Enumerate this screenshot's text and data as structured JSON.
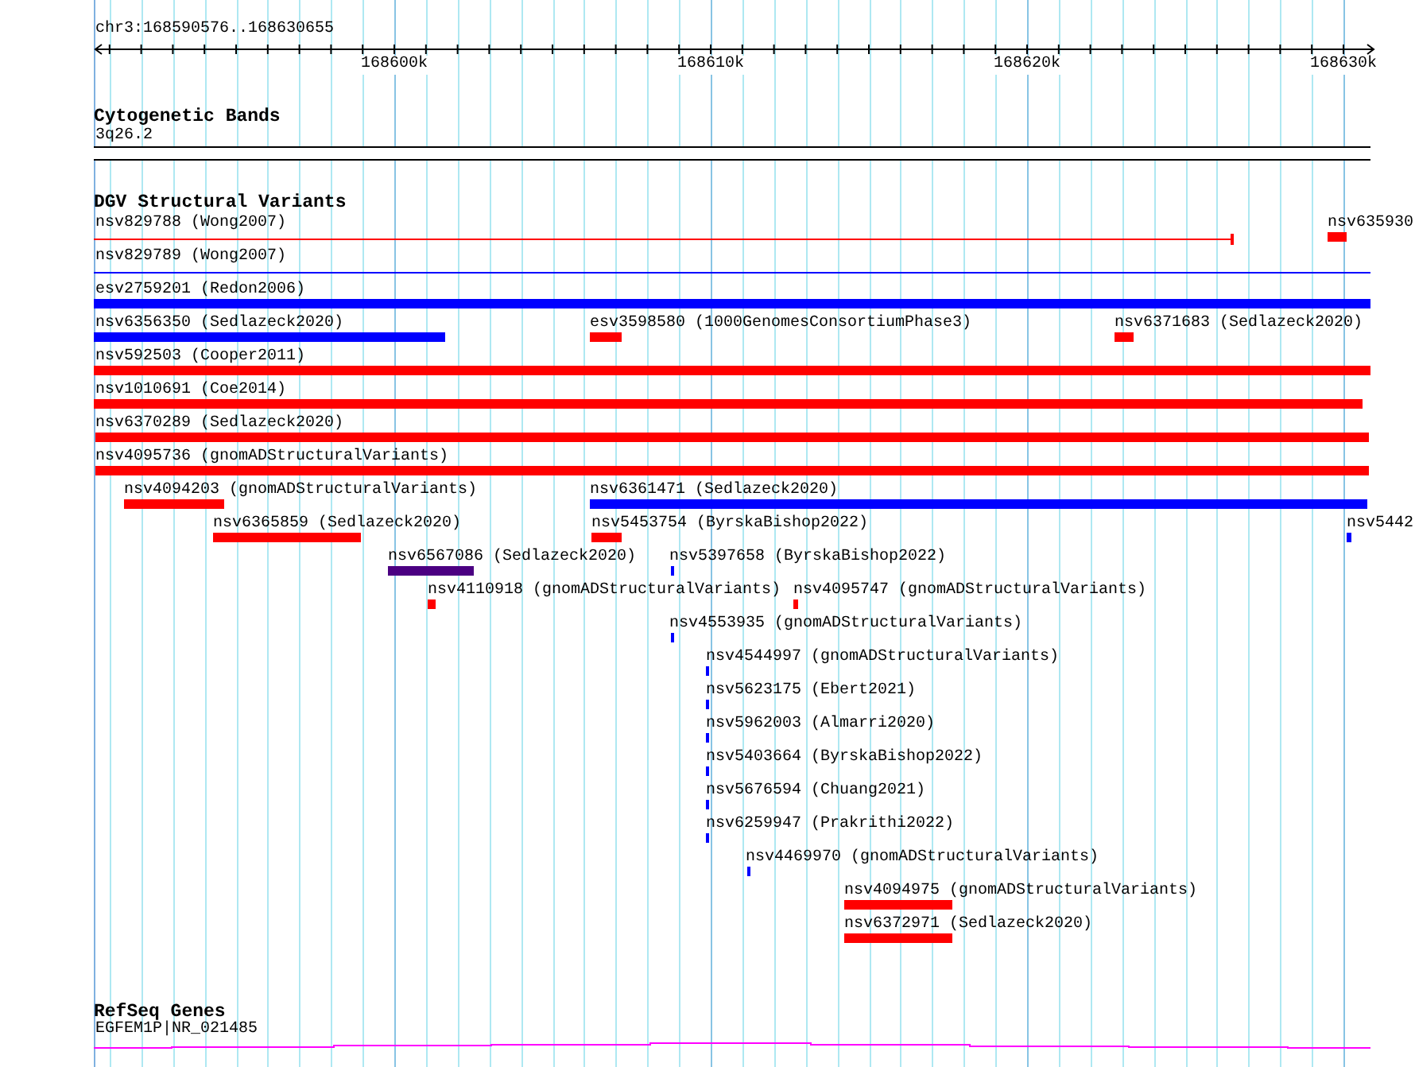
{
  "ruler": {
    "position": "chr3:168590576..168630655",
    "ticks": [
      "168600k",
      "168610k",
      "168620k",
      "168630k"
    ]
  },
  "tracks": [
    {
      "title": "Cytogenetic Bands",
      "kind": "bands",
      "items": [
        {
          "label": "3q26.2"
        }
      ]
    },
    {
      "title": "DGV Structural Variants",
      "kind": "variants",
      "items": [
        {
          "label": "nsv829788 (Wong2007)",
          "color": "#ff0000",
          "kind": "line"
        },
        {
          "label": "nsv635930",
          "color": "#ff0000",
          "kind": "bar"
        },
        {
          "label": "nsv829789 (Wong2007)",
          "color": "#0000ff",
          "kind": "line"
        },
        {
          "label": "esv2759201 (Redon2006)",
          "color": "#0000ff",
          "kind": "bar"
        },
        {
          "label": "nsv6356350 (Sedlazeck2020)",
          "color": "#0000ff",
          "kind": "bar"
        },
        {
          "label": "esv3598580 (1000GenomesConsortiumPhase3)",
          "color": "#ff0000",
          "kind": "bar"
        },
        {
          "label": "nsv6371683 (Sedlazeck2020)",
          "color": "#ff0000",
          "kind": "bar"
        },
        {
          "label": "nsv592503 (Cooper2011)",
          "color": "#ff0000",
          "kind": "bar"
        },
        {
          "label": "nsv1010691 (Coe2014)",
          "color": "#ff0000",
          "kind": "bar"
        },
        {
          "label": "nsv6370289 (Sedlazeck2020)",
          "color": "#ff0000",
          "kind": "bar"
        },
        {
          "label": "nsv4095736 (gnomADStructuralVariants)",
          "color": "#ff0000",
          "kind": "bar"
        },
        {
          "label": "nsv4094203 (gnomADStructuralVariants)",
          "color": "#ff0000",
          "kind": "bar"
        },
        {
          "label": "nsv6361471 (Sedlazeck2020)",
          "color": "#0000ff",
          "kind": "bar"
        },
        {
          "label": "nsv6365859 (Sedlazeck2020)",
          "color": "#ff0000",
          "kind": "bar"
        },
        {
          "label": "nsv5453754 (ByrskaBishop2022)",
          "color": "#ff0000",
          "kind": "bar"
        },
        {
          "label": "nsv5442",
          "color": "#0000ff",
          "kind": "bar"
        },
        {
          "label": "nsv6567086 (Sedlazeck2020)",
          "color": "#4b0082",
          "kind": "bar"
        },
        {
          "label": "nsv5397658 (ByrskaBishop2022)",
          "color": "#0000ff",
          "kind": "bar"
        },
        {
          "label": "nsv4110918 (gnomADStructuralVariants)",
          "color": "#ff0000",
          "kind": "bar"
        },
        {
          "label": "nsv4095747 (gnomADStructuralVariants)",
          "color": "#ff0000",
          "kind": "bar"
        },
        {
          "label": "nsv4553935 (gnomADStructuralVariants)",
          "color": "#0000ff",
          "kind": "bar"
        },
        {
          "label": "nsv4544997 (gnomADStructuralVariants)",
          "color": "#0000ff",
          "kind": "bar"
        },
        {
          "label": "nsv5623175 (Ebert2021)",
          "color": "#0000ff",
          "kind": "bar"
        },
        {
          "label": "nsv5962003 (Almarri2020)",
          "color": "#0000ff",
          "kind": "bar"
        },
        {
          "label": "nsv5403664 (ByrskaBishop2022)",
          "color": "#0000ff",
          "kind": "bar"
        },
        {
          "label": "nsv5676594 (Chuang2021)",
          "color": "#0000ff",
          "kind": "bar"
        },
        {
          "label": "nsv6259947 (Prakrithi2022)",
          "color": "#0000ff",
          "kind": "bar"
        },
        {
          "label": "nsv4469970 (gnomADStructuralVariants)",
          "color": "#0000ff",
          "kind": "bar"
        },
        {
          "label": "nsv4094975 (gnomADStructuralVariants)",
          "color": "#ff0000",
          "kind": "bar"
        },
        {
          "label": "nsv6372971 (Sedlazeck2020)",
          "color": "#ff0000",
          "kind": "bar"
        }
      ]
    },
    {
      "title": "RefSeq Genes",
      "kind": "genes",
      "items": [
        {
          "label": "EGFEM1P|NR_021485",
          "color": "#ff00ff"
        }
      ]
    }
  ]
}
